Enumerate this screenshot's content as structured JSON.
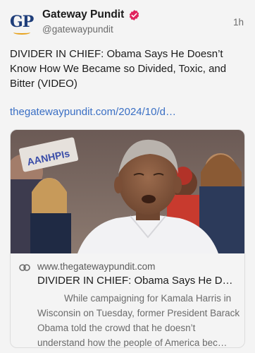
{
  "author": {
    "name": "Gateway Pundit",
    "handle": "@gatewaypundit",
    "logo_text": "GP",
    "verified": true,
    "time": "1h"
  },
  "post": {
    "text": "DIVIDER IN CHIEF: Obama Says He Doesn’t Know How We Became so Divided, Toxic, and Bitter (VIDEO)",
    "link": "thegatewaypundit.com/2024/10/d…"
  },
  "card": {
    "image_alt": "Barack Obama speaking at a campaign rally",
    "sign_text": "AANHPIs",
    "domain": "www.thegatewaypundit.com",
    "title": "DIVIDER IN CHIEF: Obama Says He D…",
    "description": "While campaigning for Kamala Harris in Wisconsin on Tuesday, former President Barack Obama told the crowd that he doesn’t understand how the people of America bec…"
  },
  "colors": {
    "logo": "#1f3e7a",
    "logo_accent": "#e7a21c",
    "verified": "#e0245e",
    "link": "#3a6fc4",
    "muted": "#6b6b6b"
  },
  "icons": {
    "verified": "verified-badge-icon",
    "link": "link-icon"
  }
}
